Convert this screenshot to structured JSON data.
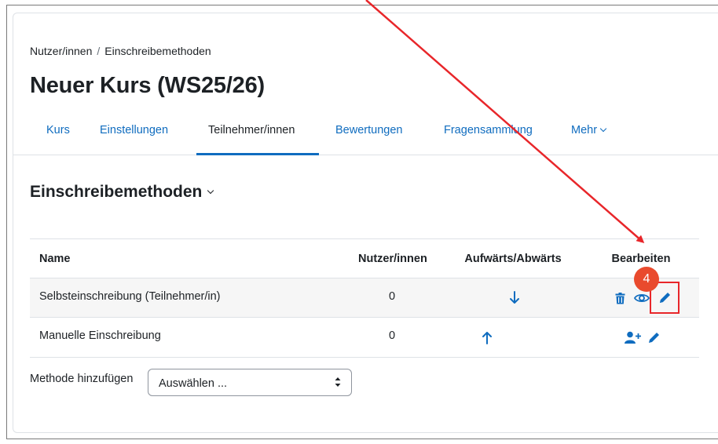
{
  "breadcrumb": {
    "item1": "Nutzer/innen",
    "separator": "/",
    "item2": "Einschreibemethoden"
  },
  "page_title": "Neuer Kurs (WS25/26)",
  "nav": {
    "tabs": [
      {
        "label": "Kurs",
        "active": false
      },
      {
        "label": "Einstellungen",
        "active": false
      },
      {
        "label": "Teilnehmer/innen",
        "active": true
      },
      {
        "label": "Bewertungen",
        "active": false
      },
      {
        "label": "Fragensammlung",
        "active": false
      },
      {
        "label": "Mehr",
        "active": false
      }
    ]
  },
  "section_title": "Einschreibemethoden",
  "table": {
    "headers": [
      "Name",
      "Nutzer/innen",
      "Aufwärts/Abwärts",
      "Bearbeiten"
    ],
    "rows": [
      {
        "name": "Selbsteinschreibung (Teilnehmer/in)",
        "users": "0",
        "move": "down-arrow-icon",
        "actions": [
          "trash-icon",
          "eye-icon",
          "pencil-icon"
        ]
      },
      {
        "name": "Manuelle Einschreibung",
        "users": "0",
        "move": "up-arrow-icon",
        "actions": [
          "add-user-icon",
          "pencil-icon"
        ]
      }
    ]
  },
  "add_method": {
    "label": "Methode hinzufügen",
    "select_value": "Auswählen ..."
  },
  "annotation": {
    "step_number": "4",
    "color": "#e8262a"
  },
  "colors": {
    "link": "#0f6cbf",
    "text": "#1d2125",
    "border": "#dee2e6"
  }
}
